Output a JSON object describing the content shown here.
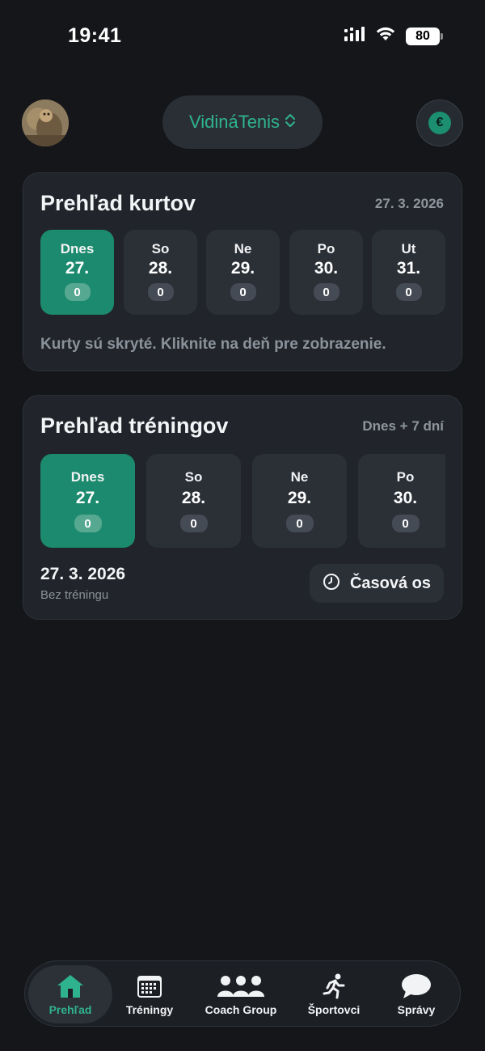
{
  "status_bar": {
    "time": "19:41",
    "battery": "80"
  },
  "header": {
    "team_name": "VidináTenis",
    "wallet_symbol": "€"
  },
  "courts": {
    "title": "Prehľad kurtov",
    "date": "27. 3. 2026",
    "days": [
      {
        "name": "Dnes",
        "num": "27.",
        "count": "0",
        "active": true
      },
      {
        "name": "So",
        "num": "28.",
        "count": "0",
        "active": false
      },
      {
        "name": "Ne",
        "num": "29.",
        "count": "0",
        "active": false
      },
      {
        "name": "Po",
        "num": "30.",
        "count": "0",
        "active": false
      },
      {
        "name": "Ut",
        "num": "31.",
        "count": "0",
        "active": false
      }
    ],
    "hint": "Kurty sú skryté. Kliknite na deň pre zobrazenie."
  },
  "trainings": {
    "title": "Prehľad tréningov",
    "range": "Dnes + 7 dní",
    "days": [
      {
        "name": "Dnes",
        "num": "27.",
        "count": "0",
        "active": true
      },
      {
        "name": "So",
        "num": "28.",
        "count": "0",
        "active": false
      },
      {
        "name": "Ne",
        "num": "29.",
        "count": "0",
        "active": false
      },
      {
        "name": "Po",
        "num": "30.",
        "count": "0",
        "active": false
      }
    ],
    "selected_date": "27. 3. 2026",
    "selected_status": "Bez tréningu",
    "timeline_label": "Časová os"
  },
  "tab_bar": {
    "items": [
      {
        "label": "Prehľad",
        "icon": "home-icon",
        "active": true
      },
      {
        "label": "Tréningy",
        "icon": "calendar-icon",
        "active": false
      },
      {
        "label": "Coach Group",
        "icon": "group-icon",
        "active": false
      },
      {
        "label": "Športovci",
        "icon": "runner-icon",
        "active": false
      },
      {
        "label": "Správy",
        "icon": "chat-bubble-icon",
        "active": false
      }
    ]
  },
  "colors": {
    "accent": "#1b8a6e",
    "accent_text": "#2fb38e",
    "background": "#141619",
    "card": "#21252b"
  }
}
